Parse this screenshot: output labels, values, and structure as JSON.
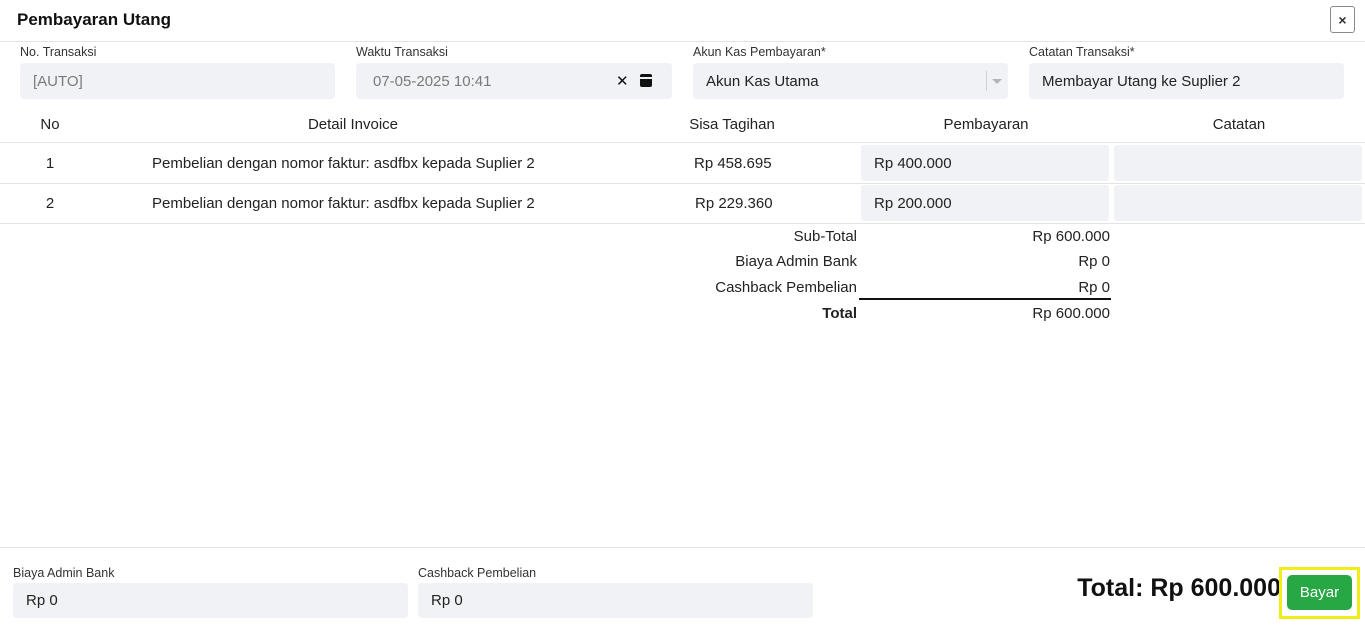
{
  "modal": {
    "title": "Pembayaran Utang",
    "close_label": "×"
  },
  "form": {
    "no_transaksi": {
      "label": "No. Transaksi",
      "value": "[AUTO]"
    },
    "waktu_transaksi": {
      "label": "Waktu Transaksi",
      "value": "07-05-2025 10:41",
      "clear_label": "✕"
    },
    "akun_kas": {
      "label": "Akun Kas Pembayaran*",
      "value": "Akun Kas Utama"
    },
    "catatan_transaksi": {
      "label": "Catatan Transaksi*",
      "value": "Membayar Utang ke Suplier 2"
    }
  },
  "table": {
    "headers": {
      "no": "No",
      "detail": "Detail Invoice",
      "sisa": "Sisa Tagihan",
      "pembayaran": "Pembayaran",
      "catatan": "Catatan"
    },
    "rows": [
      {
        "no": "1",
        "detail": "Pembelian dengan nomor faktur: asdfbx kepada Suplier 2",
        "sisa": "Rp 458.695",
        "pembayaran": "Rp 400.000",
        "catatan": ""
      },
      {
        "no": "2",
        "detail": "Pembelian dengan nomor faktur: asdfbx kepada Suplier 2",
        "sisa": "Rp 229.360",
        "pembayaran": "Rp 200.000",
        "catatan": ""
      }
    ]
  },
  "summary": {
    "subtotal": {
      "label": "Sub-Total",
      "value": "Rp 600.000"
    },
    "admin": {
      "label": "Biaya Admin Bank",
      "value": "Rp 0"
    },
    "cashback": {
      "label": "Cashback Pembelian",
      "value": "Rp 0"
    },
    "total": {
      "label": "Total",
      "value": "Rp 600.000"
    }
  },
  "footer": {
    "admin": {
      "label": "Biaya Admin Bank",
      "value": "Rp 0"
    },
    "cashback": {
      "label": "Cashback Pembelian",
      "value": "Rp 0"
    },
    "grand_total": "Total: Rp 600.000",
    "pay_label": "Bayar"
  },
  "colors": {
    "accent": "#28a745",
    "highlight": "#f2ec17",
    "field_bg": "#f1f2f5"
  },
  "icons": {
    "close": "close-icon",
    "clear": "clear-icon",
    "calendar": "calendar-icon",
    "dropdown": "chevron-down-icon"
  }
}
